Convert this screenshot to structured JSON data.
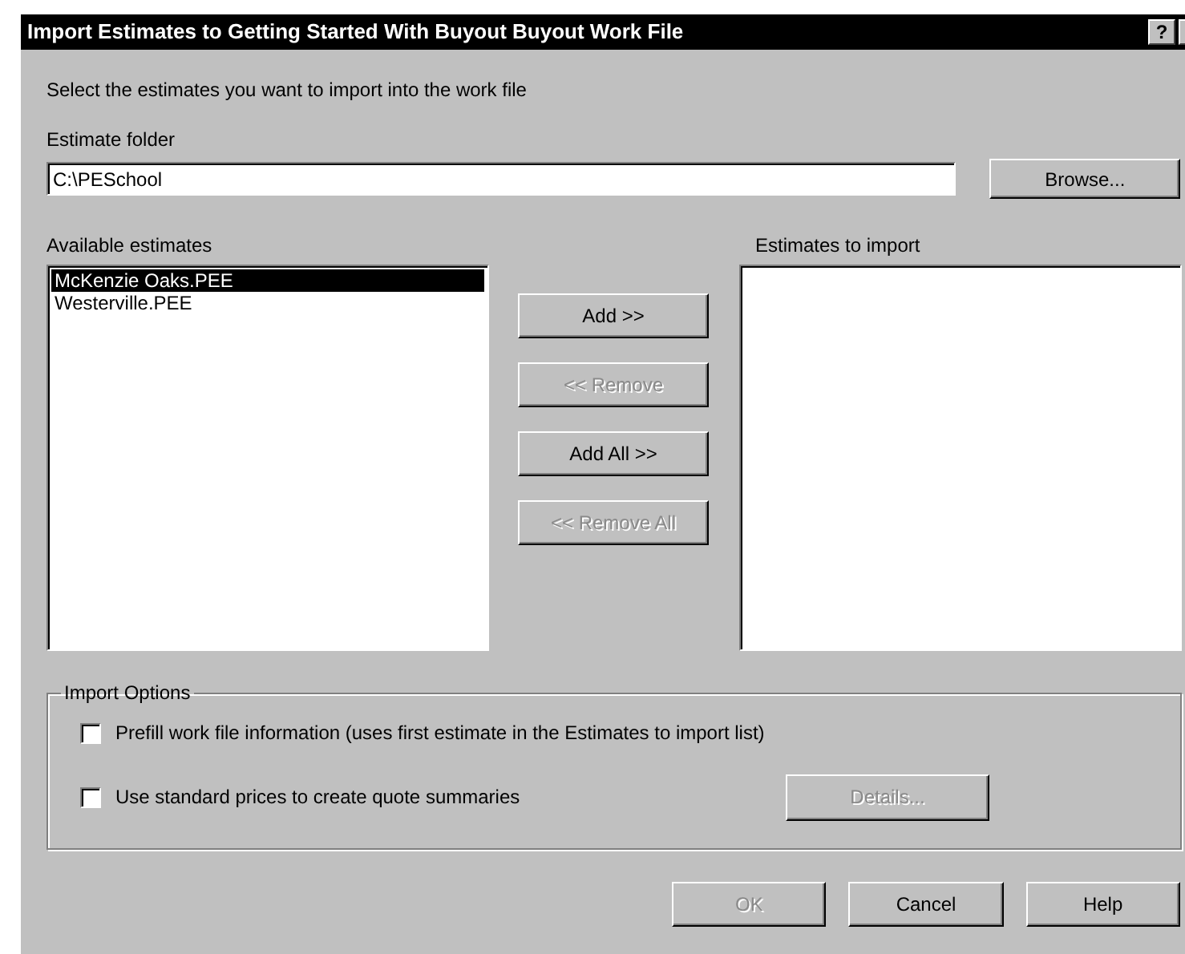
{
  "window": {
    "title": "Import Estimates to Getting Started With Buyout Buyout Work File",
    "help_glyph": "?"
  },
  "instructions": "Select the estimates you want to import into the work file",
  "estimate_folder": {
    "label": "Estimate folder",
    "value": "C:\\PESchool",
    "browse": "Browse..."
  },
  "available": {
    "label": "Available estimates",
    "items": [
      {
        "text": "McKenzie Oaks.PEE",
        "selected": true
      },
      {
        "text": "Westerville.PEE",
        "selected": false
      }
    ]
  },
  "move_buttons": [
    {
      "label": "Add >>",
      "disabled": false
    },
    {
      "label": "<< Remove",
      "disabled": true
    },
    {
      "label": "Add All >>",
      "disabled": false
    },
    {
      "label": "<< Remove All",
      "disabled": true
    }
  ],
  "to_import": {
    "label": "Estimates to import"
  },
  "import_options": {
    "title": "Import Options",
    "options": [
      {
        "label": "Prefill work file information (uses first estimate in the Estimates to import list)",
        "checked": false
      },
      {
        "label": "Use standard prices to create quote summaries",
        "checked": false,
        "details": {
          "label": "Details...",
          "disabled": true
        }
      }
    ]
  },
  "buttons": [
    {
      "label": "OK",
      "disabled": true
    },
    {
      "label": "Cancel",
      "disabled": false
    },
    {
      "label": "Help",
      "disabled": false
    }
  ]
}
